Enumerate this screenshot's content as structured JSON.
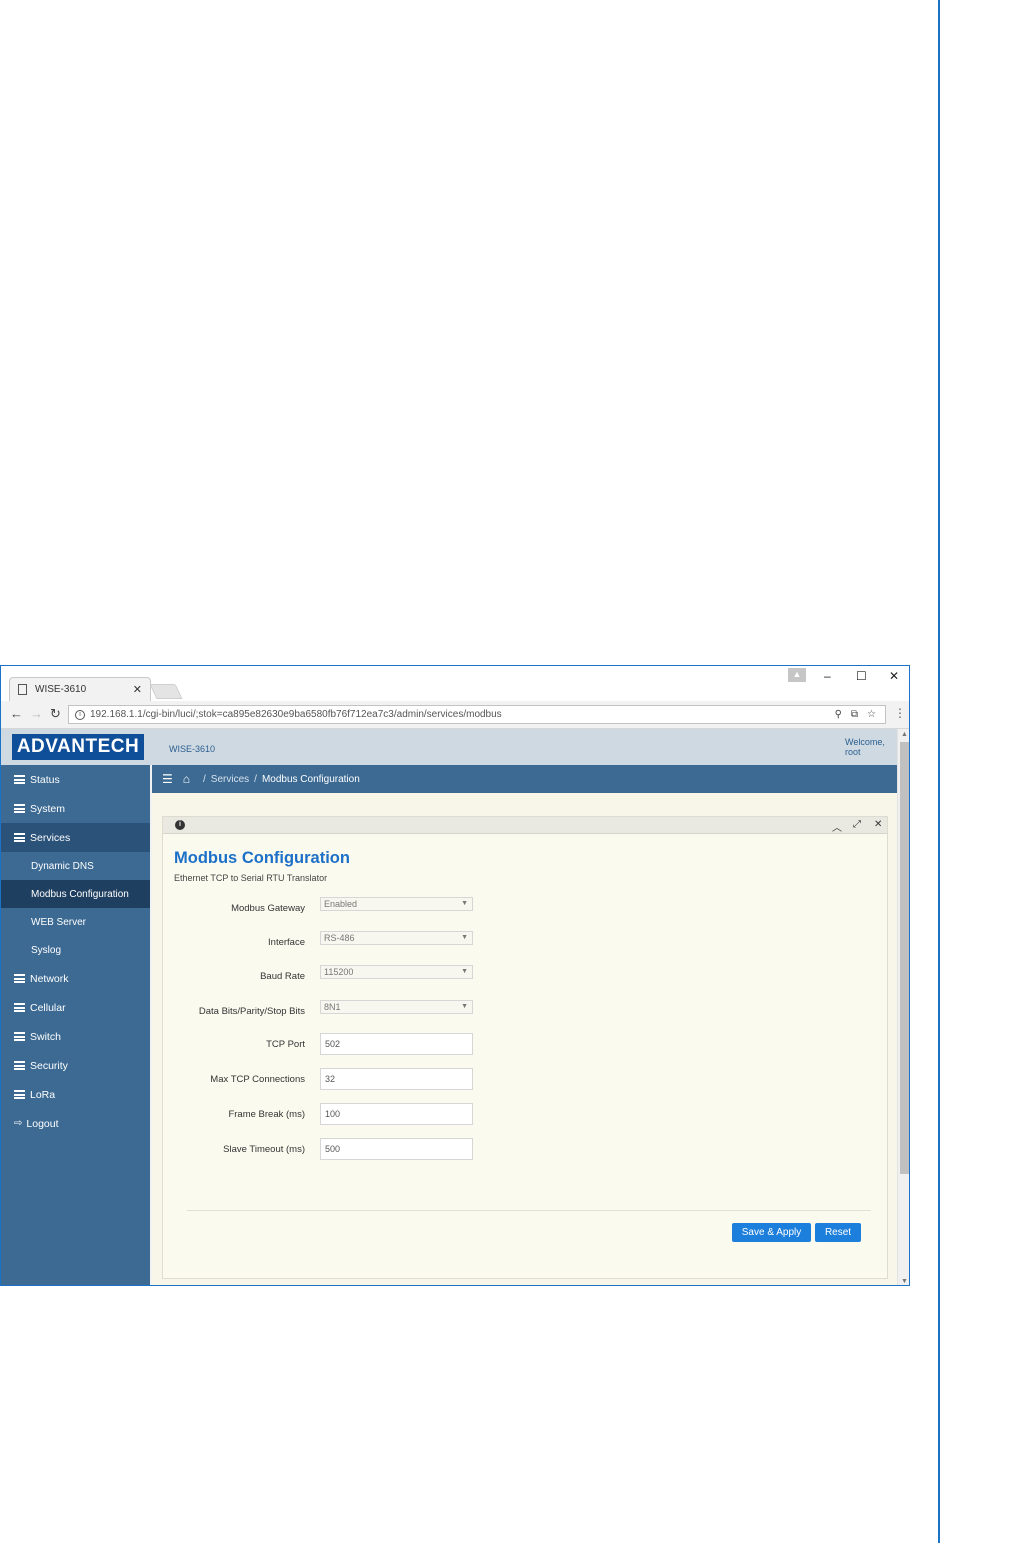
{
  "browser": {
    "tab_title": "WISE-3610",
    "url": "192.168.1.1/cgi-bin/luci/;stok=ca895e82630e9ba6580fb76f712ea7c3/admin/services/modbus"
  },
  "header": {
    "logo": "ADVANTECH",
    "device_name": "WISE-3610",
    "welcome_line1": "Welcome,",
    "welcome_line2": "root"
  },
  "sidebar": {
    "items": [
      {
        "label": "Status"
      },
      {
        "label": "System"
      },
      {
        "label": "Services"
      },
      {
        "label": "Network"
      },
      {
        "label": "Cellular"
      },
      {
        "label": "Switch"
      },
      {
        "label": "Security"
      },
      {
        "label": "LoRa"
      },
      {
        "label": "Logout"
      }
    ],
    "services_sub": [
      {
        "label": "Dynamic DNS"
      },
      {
        "label": "Modbus Configuration"
      },
      {
        "label": "WEB Server"
      },
      {
        "label": "Syslog"
      }
    ]
  },
  "breadcrumb": {
    "services": "Services",
    "sep": "/",
    "current": "Modbus Configuration"
  },
  "panel": {
    "title": "Modbus Configuration",
    "subtitle": "Ethernet TCP to Serial RTU Translator",
    "fields": {
      "modbus_gateway": {
        "label": "Modbus Gateway",
        "value": "Enabled"
      },
      "interface": {
        "label": "Interface",
        "value": "RS-486"
      },
      "baud_rate": {
        "label": "Baud Rate",
        "value": "115200"
      },
      "data_bits": {
        "label": "Data Bits/Parity/Stop Bits",
        "value": "8N1"
      },
      "tcp_port": {
        "label": "TCP Port",
        "value": "502"
      },
      "max_tcp": {
        "label": "Max TCP Connections",
        "value": "32"
      },
      "frame_break": {
        "label": "Frame Break (ms)",
        "value": "100"
      },
      "slave_timeout": {
        "label": "Slave Timeout (ms)",
        "value": "500"
      }
    },
    "save_label": "Save & Apply",
    "reset_label": "Reset"
  },
  "colors": {
    "accent": "#1d70c8",
    "sidebar": "#3c6a93",
    "button": "#1d7fdc",
    "logo_bg": "#0f4f9a"
  }
}
